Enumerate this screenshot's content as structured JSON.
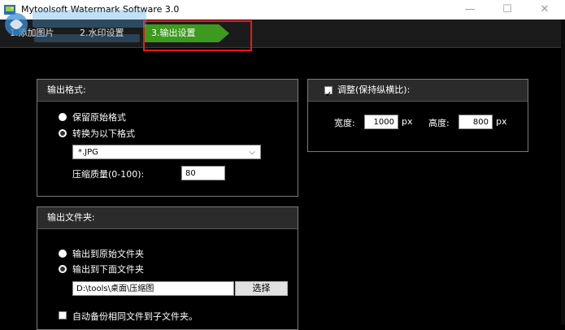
{
  "window": {
    "title": "Mytoolsoft Watermark Software 3.0",
    "min_icon": "minimize-icon",
    "max_icon": "maximize-icon",
    "close_icon": "close-icon"
  },
  "tabs": [
    {
      "label": "1.添加图片"
    },
    {
      "label": "2.水印设置"
    },
    {
      "label": "3.输出设置",
      "active": true
    }
  ],
  "output_format": {
    "header": "输出格式:",
    "keep_original": "保留原始格式",
    "convert_to": "转换为以下格式",
    "selected_format": "*.JPG",
    "quality_label": "压缩质量(0-100):",
    "quality_value": "80"
  },
  "resize": {
    "label": "调整(保持纵横比):",
    "checked": true,
    "width_label": "宽度:",
    "width_value": "1000",
    "width_unit": "px",
    "height_label": "高度:",
    "height_value": "800",
    "height_unit": "px"
  },
  "output_folder": {
    "header": "输出文件夹:",
    "to_original": "输出到原始文件夹",
    "to_below": "输出到下面文件夹",
    "path": "D:\\tools\\桌面\\压缩图",
    "browse_label": "选择",
    "backup_label": "自动备份相同文件到子文件夹。"
  },
  "colors": {
    "active_tab": "#3d9a1f",
    "highlight": "#e31b1b"
  }
}
